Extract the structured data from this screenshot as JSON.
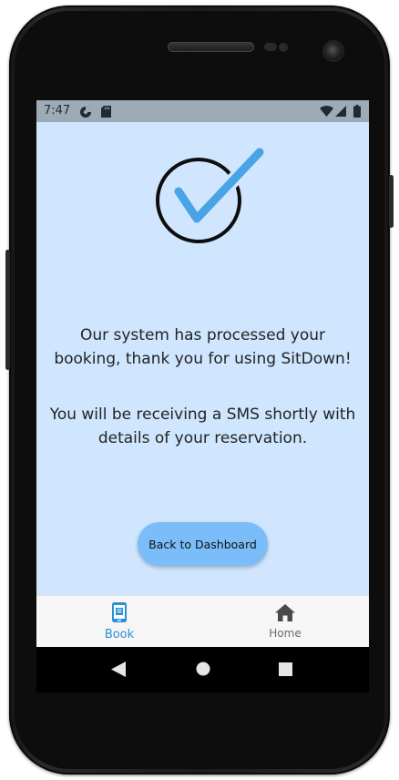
{
  "status_bar": {
    "time": "7:47",
    "left_icons": [
      "data-saver-icon",
      "sd-card-icon"
    ],
    "right_icons": [
      "wifi-icon",
      "cell-signal-icon",
      "battery-icon"
    ]
  },
  "confirmation": {
    "icon": "checkmark-circle-icon",
    "message_primary": "Our system has processed your booking, thank you for using SitDown!",
    "message_secondary": "You will be receiving a SMS shortly with details of your reservation.",
    "back_button_label": "Back to Dashboard"
  },
  "tabbar": {
    "tabs": [
      {
        "label": "Book",
        "icon": "phone-book-icon",
        "active": true
      },
      {
        "label": "Home",
        "icon": "home-icon",
        "active": false
      }
    ]
  },
  "nav": {
    "buttons": [
      "back-icon",
      "home-circle-icon",
      "recents-icon"
    ]
  },
  "colors": {
    "screen_bg": "#cfe6fe",
    "accent": "#2a90d4",
    "button_bg": "#7bbdf8",
    "check_blue": "#4aa3e4",
    "status_bar_bg": "#9eaab6"
  }
}
